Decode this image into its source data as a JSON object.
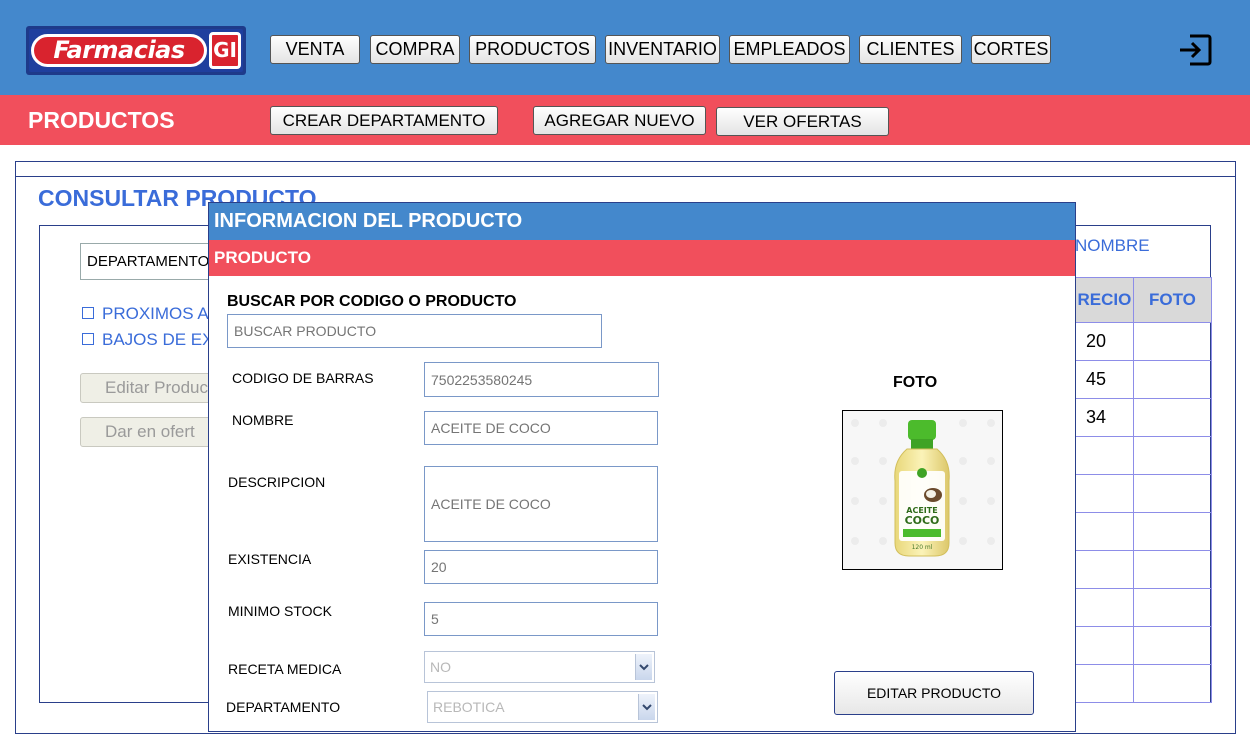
{
  "brand": {
    "logo_text": "Farmacias",
    "logo_badge": "GI"
  },
  "nav": {
    "items": [
      "VENTA",
      "COMPRA",
      "PRODUCTOS",
      "INVENTARIO",
      "EMPLEADOS",
      "CLIENTES",
      "CORTES"
    ]
  },
  "section": {
    "title": "PRODUCTOS",
    "actions": [
      "CREAR DEPARTAMENTO",
      "AGREGAR NUEVO",
      "VER OFERTAS"
    ]
  },
  "consult": {
    "title": "CONSULTAR PRODUCTO",
    "department_select": "DEPARTAMENTO",
    "checkbox_expiring": "PROXIMOS A",
    "checkbox_low_stock": "BAJOS DE EX",
    "edit_button": "Editar Produc",
    "offer_button": "Dar en ofert",
    "search_by_label": "NOMBRE",
    "table": {
      "headers": [
        "RECIO",
        "FOTO"
      ],
      "rows": [
        [
          "20",
          ""
        ],
        [
          "45",
          ""
        ],
        [
          "34",
          ""
        ],
        [
          "",
          ""
        ],
        [
          "",
          ""
        ],
        [
          "",
          ""
        ],
        [
          "",
          ""
        ],
        [
          "",
          ""
        ],
        [
          "",
          ""
        ],
        [
          "",
          ""
        ]
      ]
    }
  },
  "modal": {
    "title": "INFORMACION DEL PRODUCTO",
    "subtitle": "PRODUCTO",
    "search_label": "BUSCAR POR CODIGO O PRODUCTO",
    "search_placeholder": "BUSCAR PRODUCTO",
    "fields": {
      "barcode_label": "CODIGO DE BARRAS",
      "barcode_value": "7502253580245",
      "name_label": "NOMBRE",
      "name_value": "ACEITE DE COCO",
      "description_label": "DESCRIPCION",
      "description_value": "ACEITE DE COCO",
      "stock_label": "EXISTENCIA",
      "stock_value": "20",
      "min_stock_label": "MINIMO STOCK",
      "min_stock_value": "5",
      "prescription_label": "RECETA MEDICA",
      "prescription_value": "NO",
      "department_label": "DEPARTAMENTO",
      "department_value": "REBOTICA"
    },
    "photo_label": "FOTO",
    "photo": {
      "product_line1": "ACEITE",
      "product_line2": "COCO",
      "product_volume": "120 ml"
    },
    "edit_button": "EDITAR PRODUCTO"
  },
  "colors": {
    "top_bar": "#4488cc",
    "red_bar": "#f14f5c",
    "accent_blue": "#3a6cd9"
  }
}
